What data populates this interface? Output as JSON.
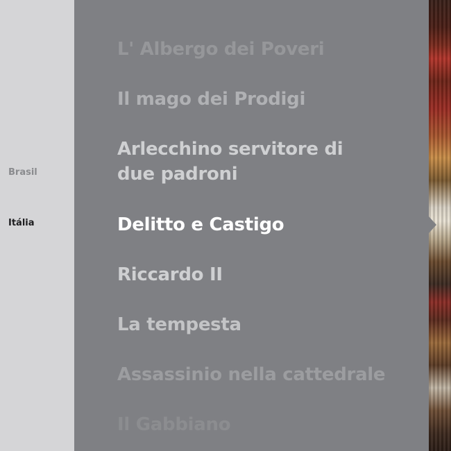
{
  "countries": [
    {
      "label": "Brasil",
      "selected": false
    },
    {
      "label": "Itália",
      "selected": true
    }
  ],
  "titles": [
    {
      "label": "L' Albergo dei Poveri",
      "color": "#96979a"
    },
    {
      "label": "Il mago dei Prodigi",
      "color": "#b0b1b4"
    },
    {
      "label": "Arlecchino servitore di due padroni",
      "color": "#cfd0d2"
    },
    {
      "label": "Delitto e Castigo",
      "color": "#ffffff",
      "selected": true
    },
    {
      "label": "Riccardo II",
      "color": "#cfd0d2"
    },
    {
      "label": "La tempesta",
      "color": "#c3c4c6"
    },
    {
      "label": "Assassinio nella cattedrale",
      "color": "#9c9da0"
    },
    {
      "label": "Il Gabbiano",
      "color": "#8c8d90"
    }
  ]
}
